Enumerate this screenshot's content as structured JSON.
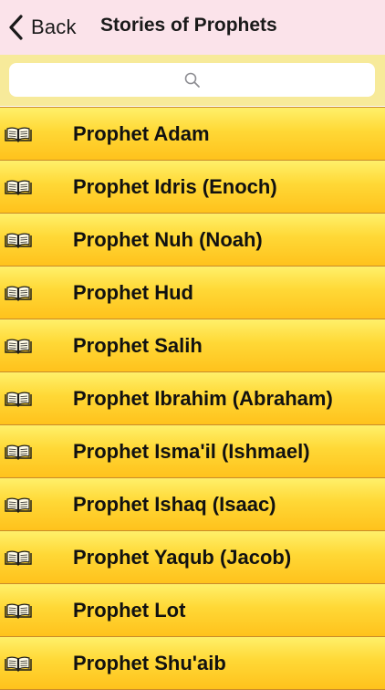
{
  "navbar": {
    "back_label": "Back",
    "title": "Stories of Prophets",
    "background": "#fbe3ea"
  },
  "search": {
    "placeholder": "",
    "icon": "search-icon",
    "bar_color": "#f7ea9a"
  },
  "list": {
    "item_icon": "book-icon",
    "item_gradient": [
      "#fff06a",
      "#ffc21c"
    ],
    "items": [
      {
        "label": "Prophet Adam"
      },
      {
        "label": "Prophet Idris (Enoch)"
      },
      {
        "label": "Prophet Nuh (Noah)"
      },
      {
        "label": "Prophet Hud"
      },
      {
        "label": "Prophet Salih"
      },
      {
        "label": "Prophet Ibrahim (Abraham)"
      },
      {
        "label": "Prophet Isma'il (Ishmael)"
      },
      {
        "label": "Prophet Ishaq (Isaac)"
      },
      {
        "label": "Prophet Yaqub (Jacob)"
      },
      {
        "label": "Prophet Lot"
      },
      {
        "label": "Prophet Shu'aib"
      }
    ]
  }
}
